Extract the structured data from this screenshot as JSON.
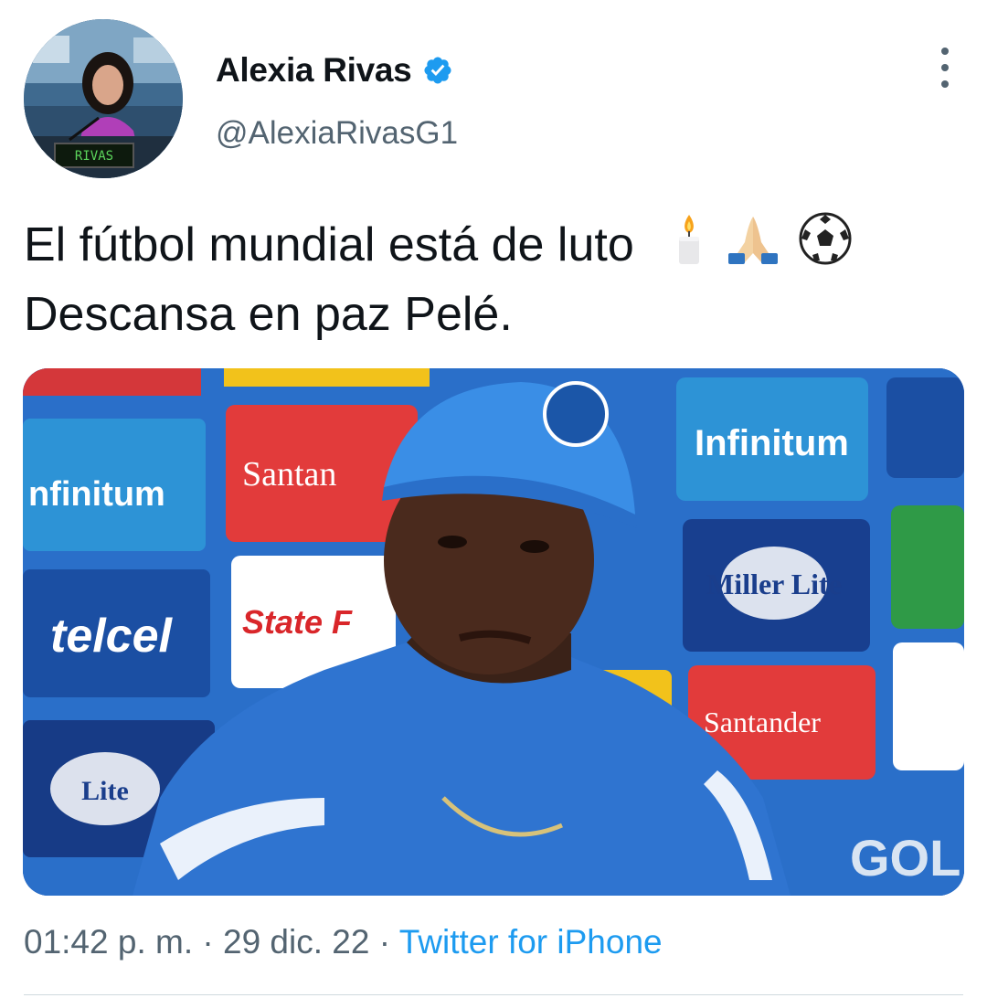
{
  "author": {
    "display_name": "Alexia Rivas",
    "handle": "@AlexiaRivasG1",
    "verified": true,
    "avatar_nameplate": "RIVAS"
  },
  "tweet": {
    "line1": "El fútbol mundial está de luto",
    "line2": "Descansa en paz Pelé.",
    "emojis": [
      "candle-emoji",
      "folded-hands-emoji",
      "soccer-ball-emoji"
    ]
  },
  "media": {
    "sponsor_boards": [
      "nfinitum",
      "Santan",
      "telcel",
      "State F",
      "Miller Lite",
      "Infinitum",
      "Santander",
      "GOL"
    ]
  },
  "meta": {
    "time": "01:42 p. m.",
    "separator": "·",
    "date": "29 dic. 22",
    "source": "Twitter for iPhone"
  },
  "colors": {
    "text": "#0f1419",
    "secondary": "#536471",
    "accent": "#1d9bf0"
  }
}
